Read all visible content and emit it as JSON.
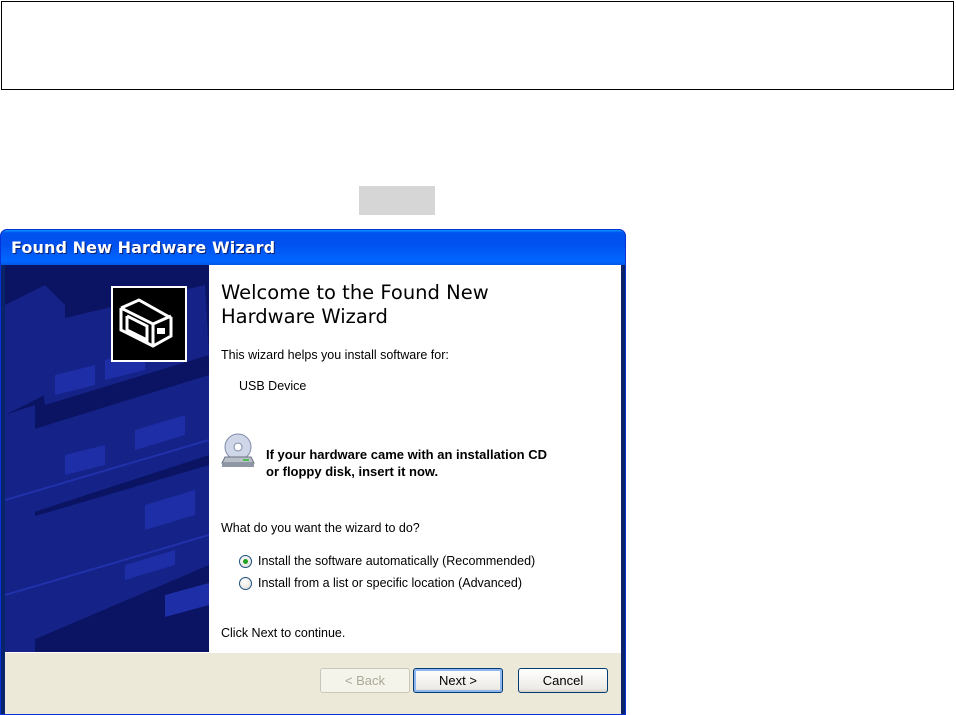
{
  "dialog": {
    "title": "Found New Hardware Wizard",
    "heading_line1": "Welcome to the Found New",
    "heading_line2": "Hardware Wizard",
    "intro": "This wizard helps you install software for:",
    "device": "USB Device",
    "cd_message_line1": "If your hardware came with an installation CD",
    "cd_message_line2": "or floppy disk, insert it now.",
    "question": "What do you want the wizard to do?",
    "options": [
      {
        "label": "Install the software automatically (Recommended)",
        "selected": true
      },
      {
        "label": "Install from a list or specific location (Advanced)",
        "selected": false
      }
    ],
    "footer_hint": "Click Next to continue.",
    "buttons": {
      "back": "< Back",
      "next": "Next >",
      "cancel": "Cancel"
    }
  },
  "colors": {
    "titlebar": "#0054e3",
    "sidebar": "#0a1463",
    "radio_dot": "#21a121"
  }
}
